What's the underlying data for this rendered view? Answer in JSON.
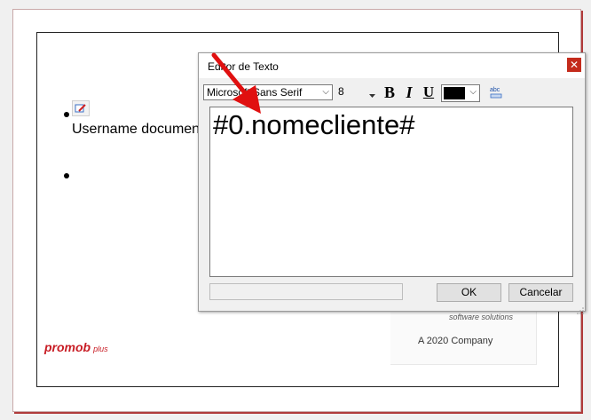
{
  "document": {
    "username_text": "Username document",
    "tagline": "software solutions",
    "company": "A 2020 Company",
    "logo_text": "promob",
    "logo_plus": "plus"
  },
  "dialog": {
    "title": "Editor de Texto",
    "close_glyph": "✕",
    "toolbar": {
      "font_name": "Microsoft Sans Serif",
      "font_size": "8",
      "bold_label": "B",
      "italic_label": "I",
      "underline_label": "U",
      "text_color": "#000000"
    },
    "editor_text": "#0.nomecliente#",
    "ok_label": "OK",
    "cancel_label": "Cancelar"
  },
  "colors": {
    "accent_red": "#c81d25",
    "arrow_red": "#e01010",
    "close_red": "#c42b1c"
  }
}
